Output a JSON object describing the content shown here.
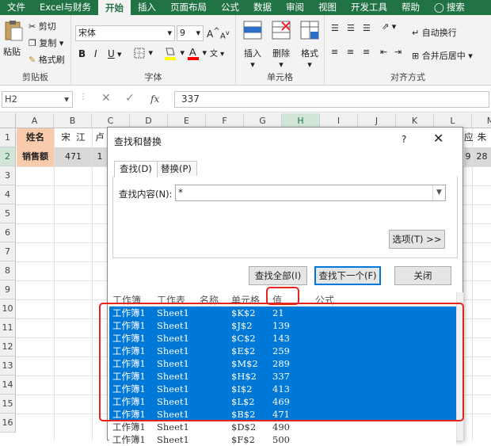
{
  "tabs": [
    "文件",
    "Excel与财务",
    "开始",
    "插入",
    "页面布局",
    "公式",
    "数据",
    "审阅",
    "视图",
    "开发工具",
    "帮助",
    "搜索"
  ],
  "ribbon": {
    "clipboard": {
      "paste": "粘贴",
      "cut": "剪切",
      "copy": "复制",
      "format_painter": "格式刷",
      "label": "剪贴板"
    },
    "font": {
      "name": "宋体",
      "size": "9",
      "bold": "B",
      "italic": "I",
      "underline": "U",
      "label": "字体",
      "grow": "A",
      "shrink": "A"
    },
    "cells": {
      "insert": "插入",
      "delete": "删除",
      "format": "格式",
      "label": "单元格"
    },
    "align": {
      "wrap": "自动换行",
      "merge": "合并后居中",
      "label": "对齐方式"
    }
  },
  "formula": {
    "namebox": "H2",
    "value": "337",
    "fx": "fx"
  },
  "sheet": {
    "columns": [
      "A",
      "B",
      "C",
      "D",
      "E",
      "F",
      "G",
      "H",
      "I",
      "J",
      "K",
      "L",
      "M"
    ],
    "rows": [
      "1",
      "2",
      "3",
      "4",
      "5",
      "6",
      "7",
      "8",
      "9",
      "10",
      "11",
      "12",
      "13",
      "14",
      "15",
      "16"
    ],
    "a1": "姓名",
    "b1": "宋  江",
    "c1": "卢",
    "l1": "应",
    "m1": "朱",
    "a2": "销售额",
    "b2": "471",
    "c2": "1",
    "l2": "9",
    "m2": "28"
  },
  "dialog": {
    "title": "查找和替换",
    "help": "?",
    "close": "✕",
    "tab_find": "查找(D)",
    "tab_replace": "替换(P)",
    "find_label": "查找内容(N):",
    "find_value": "*",
    "options": "选项(T) >>",
    "find_all": "查找全部(I)",
    "find_next": "查找下一个(F)",
    "close_btn": "关闭",
    "columns": [
      "工作簿",
      "工作表",
      "名称",
      "单元格",
      "值",
      "公式"
    ],
    "results": [
      {
        "book": "工作簿1",
        "sheet": "Sheet1",
        "cell": "$K$2",
        "value": "21",
        "selected": true
      },
      {
        "book": "工作簿1",
        "sheet": "Sheet1",
        "cell": "$J$2",
        "value": "139",
        "selected": true
      },
      {
        "book": "工作簿1",
        "sheet": "Sheet1",
        "cell": "$C$2",
        "value": "143",
        "selected": true
      },
      {
        "book": "工作簿1",
        "sheet": "Sheet1",
        "cell": "$E$2",
        "value": "259",
        "selected": true
      },
      {
        "book": "工作簿1",
        "sheet": "Sheet1",
        "cell": "$M$2",
        "value": "289",
        "selected": true
      },
      {
        "book": "工作簿1",
        "sheet": "Sheet1",
        "cell": "$H$2",
        "value": "337",
        "selected": true
      },
      {
        "book": "工作簿1",
        "sheet": "Sheet1",
        "cell": "$I$2",
        "value": "413",
        "selected": true
      },
      {
        "book": "工作簿1",
        "sheet": "Sheet1",
        "cell": "$L$2",
        "value": "469",
        "selected": true
      },
      {
        "book": "工作簿1",
        "sheet": "Sheet1",
        "cell": "$B$2",
        "value": "471",
        "selected": true
      },
      {
        "book": "工作簿1",
        "sheet": "Sheet1",
        "cell": "$D$2",
        "value": "490",
        "selected": false
      },
      {
        "book": "工作簿1",
        "sheet": "Sheet1",
        "cell": "$F$2",
        "value": "500",
        "selected": false
      }
    ]
  },
  "colors": {
    "excel_green": "#217346",
    "selection": "#0078d7",
    "highlight_red": "#e5231f",
    "header_fill": "#f8cbad"
  }
}
